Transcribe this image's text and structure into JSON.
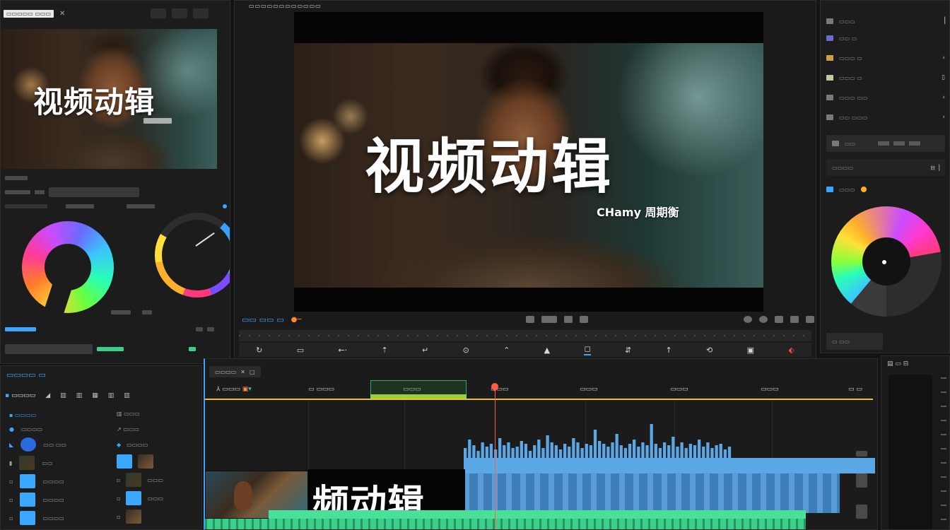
{
  "source": {
    "caption": "视频动辑"
  },
  "program": {
    "caption": "视频动辑",
    "subtitle": "CHamy 周期衡"
  },
  "timeline": {
    "caption": "频动辑"
  },
  "waveform": [
    22,
    34,
    26,
    18,
    30,
    24,
    28,
    20,
    36,
    26,
    30,
    22,
    24,
    32,
    28,
    18,
    26,
    34,
    22,
    40,
    30,
    26,
    20,
    28,
    24,
    36,
    30,
    22,
    28,
    26,
    48,
    32,
    28,
    24,
    30,
    42,
    26,
    22,
    28,
    34,
    24,
    30,
    26,
    56,
    28,
    22,
    30,
    26,
    38,
    24,
    30,
    22,
    28,
    26,
    34,
    24,
    30,
    22,
    26,
    28,
    20,
    24
  ],
  "colors": {
    "accent": "#3ba6ff",
    "playhead": "#ff5a4a",
    "work_area": "#e6c23a",
    "audio_track": "#5aa8e6",
    "audio_track_2": "#3ad08a"
  },
  "icons": [
    "play-icon",
    "arrow-left-icon",
    "arrow-up-icon",
    "loop-icon",
    "marker-icon",
    "record-icon",
    "settings-icon",
    "color-wheel-icon",
    "chevron-right-icon"
  ]
}
